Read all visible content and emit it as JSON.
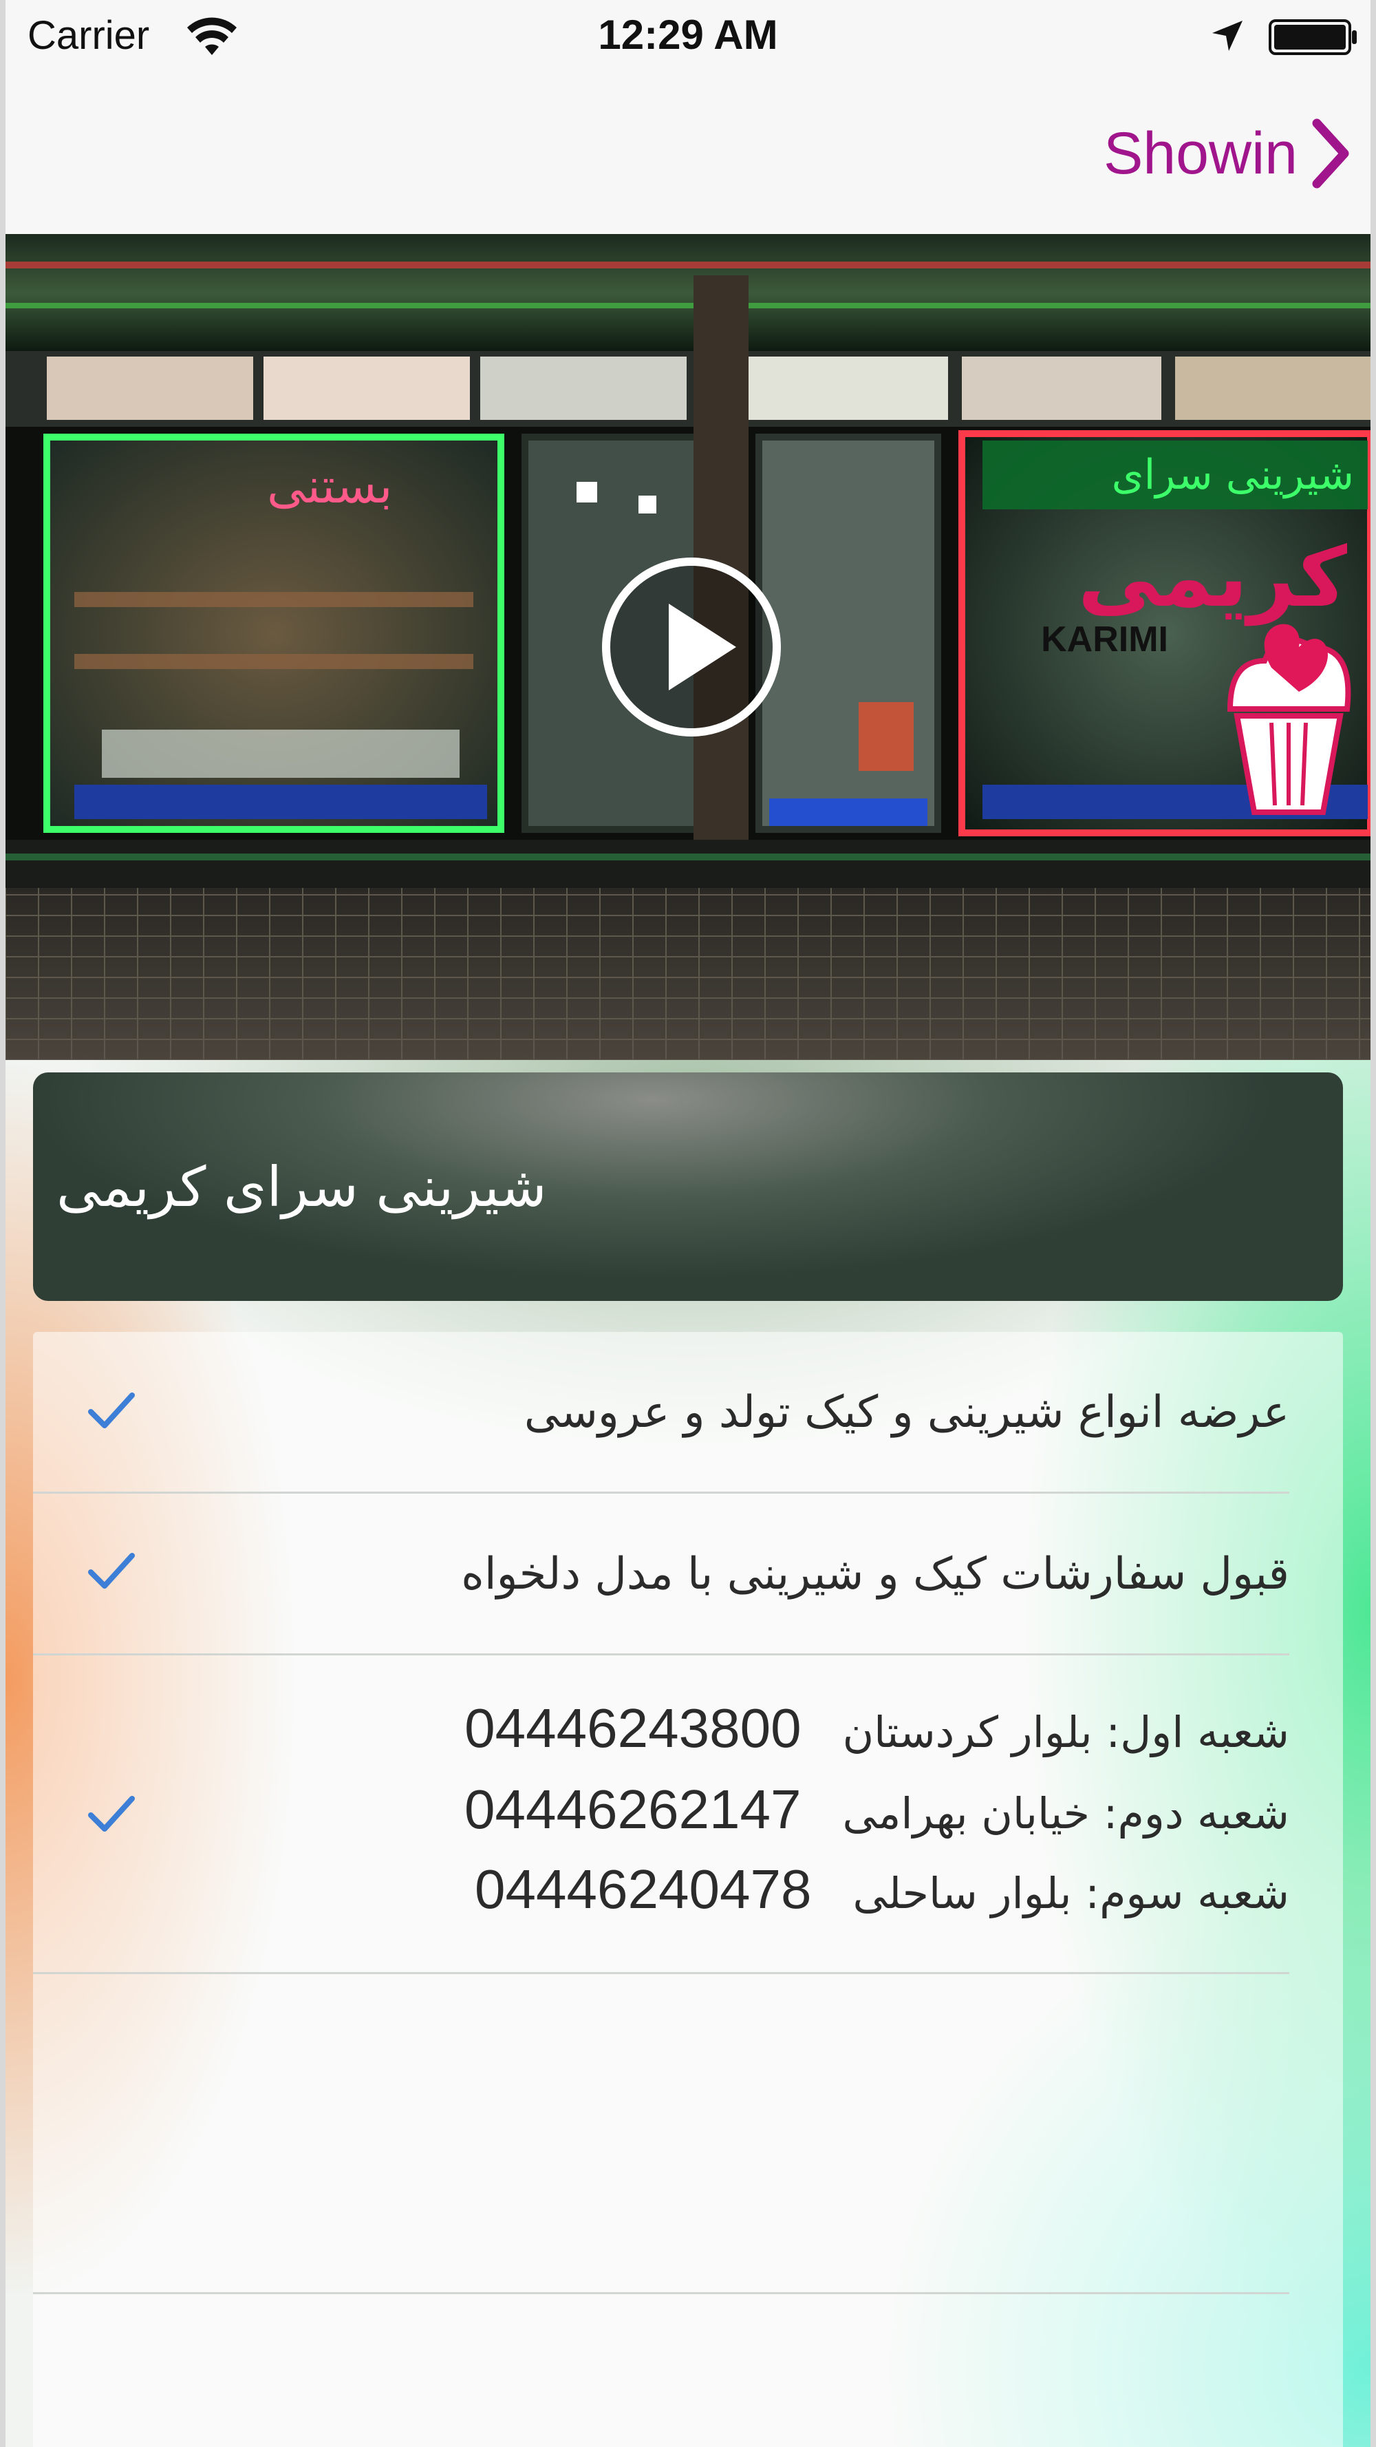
{
  "status_bar": {
    "carrier": "Carrier",
    "time": "12:29 AM",
    "icons": [
      "wifi-icon",
      "location-icon",
      "battery-icon"
    ]
  },
  "nav": {
    "forward_label": "Showin",
    "forward_icon": "chevron-right-icon",
    "accent_color": "#a0148c"
  },
  "hero": {
    "play_icon": "play-icon",
    "sign_text": "کریمی",
    "sign_latin": "KARIMI"
  },
  "title": "شیرینی سرای کریمی",
  "items": [
    {
      "text": "عرضه انواع شیرینی و کیک تولد و عروسی",
      "checked": true
    },
    {
      "text": "قبول سفارشات کیک و شیرینی با مدل دلخواه",
      "checked": true
    }
  ],
  "branches": [
    {
      "address": "شعبه اول: بلوار کردستان",
      "phone": "04446243800"
    },
    {
      "address": "شعبه دوم: خیابان بهرامی",
      "phone": "04446262147"
    },
    {
      "address": "شعبه سوم: بلوار ساحلی",
      "phone": "04446240478"
    }
  ],
  "check_color": "#3d7fd6"
}
